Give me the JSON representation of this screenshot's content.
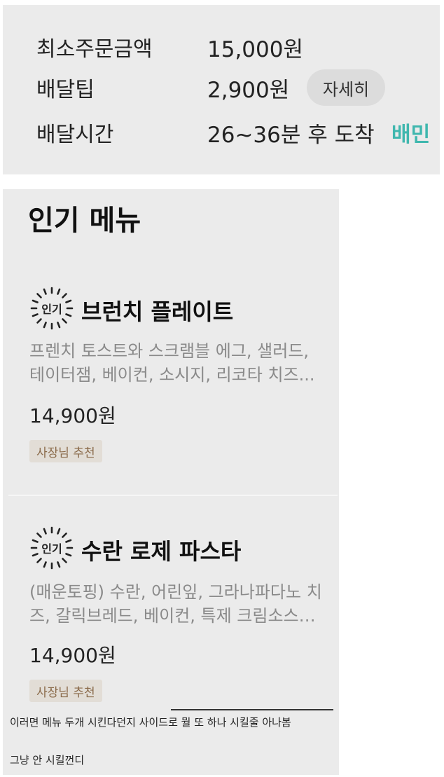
{
  "store_info": {
    "rows": [
      {
        "label": "최소주문금액",
        "value": "15,000원"
      },
      {
        "label": "배달팁",
        "value": "2,900원"
      },
      {
        "label": "배달시간",
        "value": "26~36분 후 도착"
      }
    ],
    "detail_button": "자세히",
    "brand_badge": "배민"
  },
  "popular_menu": {
    "title": "인기 메뉴",
    "badge_label": "인기",
    "items": [
      {
        "name": "브런치 플레이트",
        "desc_line1": "프렌치 토스트와 스크램블 에그, 샐러드,",
        "desc_line2": "테이터잼, 베이컨, 소시지, 리코타 치즈...",
        "price": "14,900원",
        "tag": "사장님 추천"
      },
      {
        "name": "수란 로제 파스타",
        "desc_line1": "(매운토핑) 수란, 어린잎, 그라나파다노 치",
        "desc_line2": "즈, 갈릭브레드, 베이컨, 특제 크림소스…",
        "price": "14,900원",
        "tag": "사장님 추천"
      }
    ]
  },
  "comment": {
    "line1": "이러면 메뉴 두개 시킨다던지 사이드로 뭘 또 하나 시킬줄 아나봄",
    "line2": "그냥 안 시킬껀디"
  }
}
